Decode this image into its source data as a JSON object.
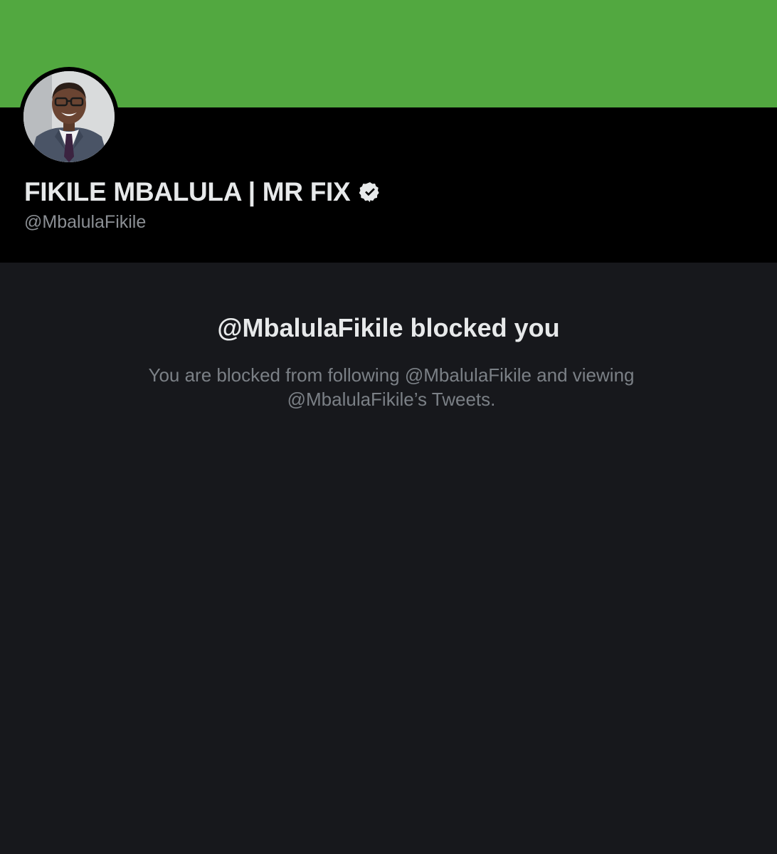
{
  "profile": {
    "display_name": "FIKILE MBALULA | MR FIX",
    "handle": "@MbalulaFikile",
    "verified_icon": "verified-badge-icon",
    "banner_color": "#52a840"
  },
  "blocked": {
    "title": "@MbalulaFikile blocked you",
    "description": "You are blocked from following @MbalulaFikile and viewing @MbalulaFikile’s Tweets."
  }
}
